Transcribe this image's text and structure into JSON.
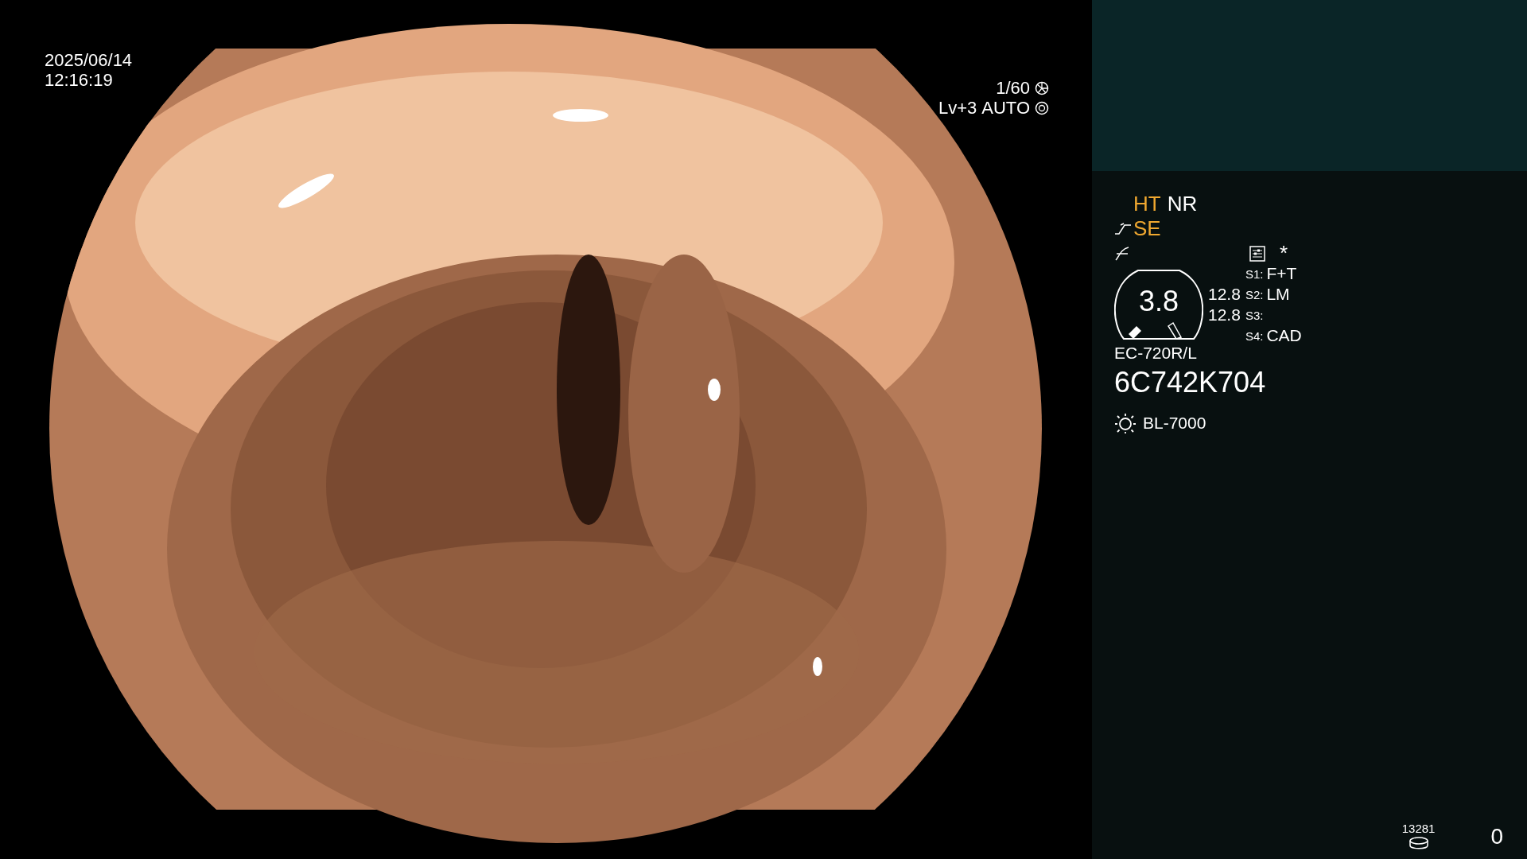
{
  "video": {
    "kind": "picture",
    "date": "2025/06/14",
    "time": "12:16:19",
    "shutter": "1/60",
    "brightness": "Lv+3",
    "iris": "AUTO"
  },
  "panel": {
    "modes": [
      {
        "label": "HT",
        "active": true
      },
      {
        "label": "NR",
        "active": false
      }
    ],
    "enhance": {
      "label": "SE",
      "active": true
    },
    "marker": "*",
    "zoom": "3.8",
    "readings": [
      "12.8",
      "12.8"
    ],
    "switches": [
      {
        "key": "S1:",
        "value": "F+T"
      },
      {
        "key": "S2:",
        "value": "LM"
      },
      {
        "key": "S3:"
      },
      {
        "key": "S4:",
        "value": "CAD"
      }
    ],
    "scope": "EC-720R/L",
    "serial": "6C742K704",
    "light": "BL-7000",
    "count": "13281",
    "counter": "0"
  }
}
